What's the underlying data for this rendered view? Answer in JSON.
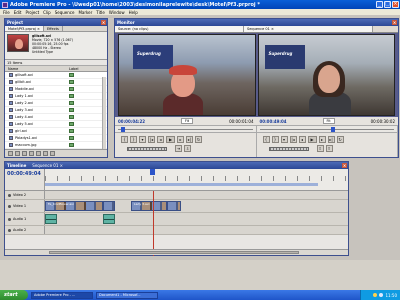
{
  "window": {
    "title": "Adobe Premiere Pro - \\Uwedp01\\home\\2003\\desimonilaprelewite\\desk\\Motel\\Pf3.prproj *"
  },
  "menu": [
    "File",
    "Edit",
    "Project",
    "Clip",
    "Sequence",
    "Marker",
    "Title",
    "Window",
    "Help"
  ],
  "project": {
    "panel_title": "Project",
    "tabs": [
      "Motel\\Pf3.prproj ×",
      "Effects"
    ],
    "clip": {
      "name": "gillsoft.avi",
      "line1": "Movie, 720 × 576 (1.067)",
      "line2": "00:00:05:16, 25.00 fps",
      "line3": "48000 Hz - Stereo",
      "line4": "Untitled Type"
    },
    "count": "15 Items",
    "columns": {
      "name": "Name",
      "label": "Label"
    },
    "files": [
      "gillsoft.avi",
      "gillbit.avi",
      "Maddie.avi",
      "Lady 1.avi",
      "Lady 2.avi",
      "Lady 3.avi",
      "Lady 4.avi",
      "Lady 5.avi",
      "girl.avi",
      "Pbladys1.avi",
      "maccom.jpg"
    ]
  },
  "monitor": {
    "panel_title": "Monitor",
    "source_tab": "Source: (no clips)",
    "program_tab": "Sequence 01 ×",
    "source_sign": "Superdrug",
    "program_sign": "Superdrug",
    "source_tc": "00:00:04:22",
    "source_duration": "00:00:01:04",
    "program_tc": "00:00:49:04",
    "program_duration": "00:00:30:02",
    "fit_left": "Fit",
    "fit_right": "Fit"
  },
  "timeline": {
    "panel_title": "Timeline",
    "tab": "Sequence 01 ×",
    "timecode": "00:00:49:04",
    "tracks": [
      {
        "name": "Video 2",
        "clips": []
      },
      {
        "name": "Video 1",
        "clips": [
          {
            "label": "Fe_Kindflower.avi",
            "kind": "v"
          },
          {
            "label": "",
            "kind": "v"
          },
          {
            "label": "Lady 3.avi",
            "kind": "v"
          },
          {
            "label": "",
            "kind": "v"
          }
        ]
      },
      {
        "name": "Audio 1",
        "clips": [
          {
            "label": "",
            "kind": "a"
          },
          {
            "label": "",
            "kind": "a"
          }
        ]
      },
      {
        "name": "Audio 2",
        "clips": []
      }
    ]
  },
  "taskbar": {
    "start": "start",
    "tasks": [
      "Adobe Premiere Pro - ...",
      "Document1 - Microsof..."
    ],
    "clock": "11:50"
  }
}
